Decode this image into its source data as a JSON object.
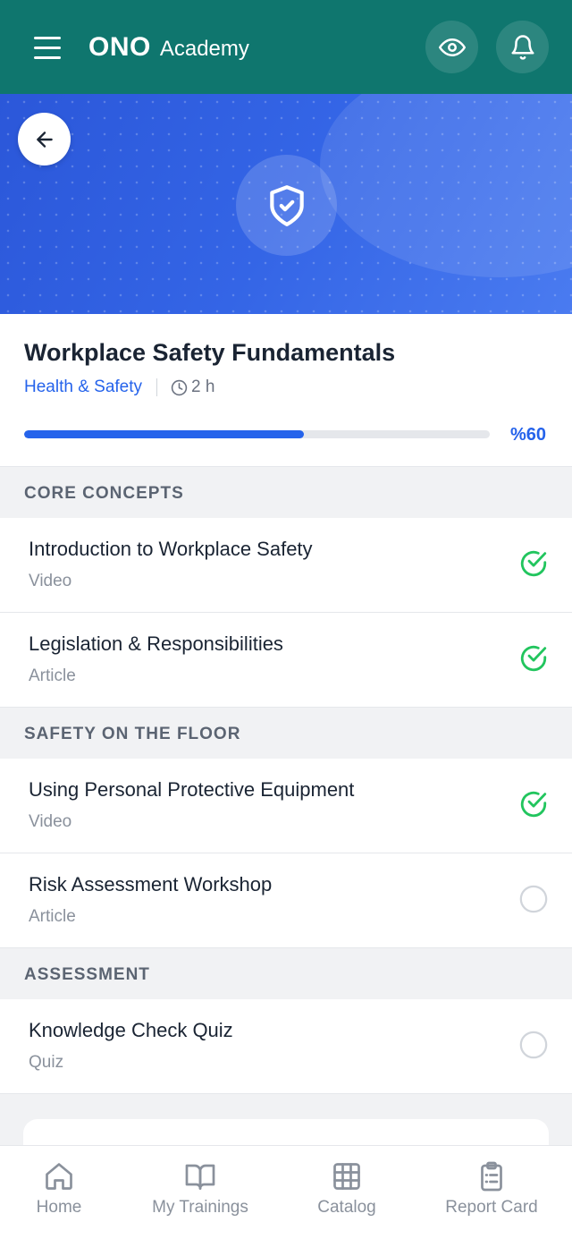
{
  "header": {
    "brand_bold": "ONO",
    "brand_light": "Academy",
    "color": "#0f766e"
  },
  "hero": {
    "icon": "shield-check-icon",
    "gradient": [
      "#2b57d9",
      "#4a7bf0"
    ]
  },
  "course": {
    "title": "Workplace Safety Fundamentals",
    "category": "Health & Safety",
    "duration": "2 h",
    "progress_percent": 60,
    "progress_label": "%60",
    "accent": "#2563eb"
  },
  "sections": [
    {
      "title": "CORE CONCEPTS",
      "lessons": [
        {
          "title": "Introduction to Workplace Safety",
          "type": "Video",
          "completed": true
        },
        {
          "title": "Legislation & Responsibilities",
          "type": "Article",
          "completed": true
        }
      ]
    },
    {
      "title": "SAFETY ON THE FLOOR",
      "lessons": [
        {
          "title": "Using Personal Protective Equipment",
          "type": "Video",
          "completed": true
        },
        {
          "title": "Risk Assessment Workshop",
          "type": "Article",
          "completed": false
        }
      ]
    },
    {
      "title": "ASSESSMENT",
      "lessons": [
        {
          "title": "Knowledge Check Quiz",
          "type": "Quiz",
          "completed": false
        }
      ]
    }
  ],
  "status_colors": {
    "completed": "#22c55e",
    "pending": "#d1d5db"
  },
  "nav": [
    {
      "label": "Home",
      "icon": "home-icon"
    },
    {
      "label": "My Trainings",
      "icon": "book-icon"
    },
    {
      "label": "Catalog",
      "icon": "grid-icon"
    },
    {
      "label": "Report Card",
      "icon": "clipboard-icon"
    }
  ]
}
